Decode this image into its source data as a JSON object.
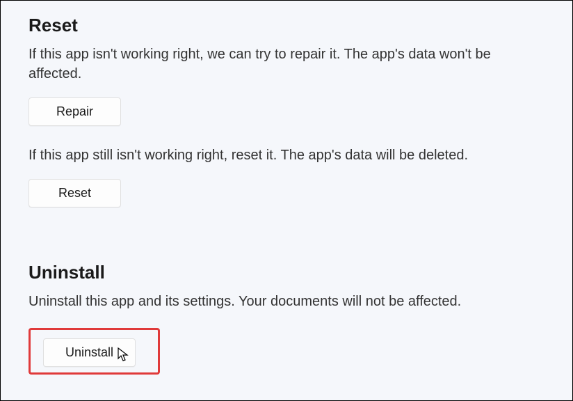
{
  "reset_section": {
    "title": "Reset",
    "repair_text": "If this app isn't working right, we can try to repair it. The app's data won't be affected.",
    "repair_button": "Repair",
    "reset_text": "If this app still isn't working right, reset it. The app's data will be deleted.",
    "reset_button": "Reset"
  },
  "uninstall_section": {
    "title": "Uninstall",
    "text": "Uninstall this app and its settings. Your documents will not be affected.",
    "uninstall_button": "Uninstall"
  }
}
